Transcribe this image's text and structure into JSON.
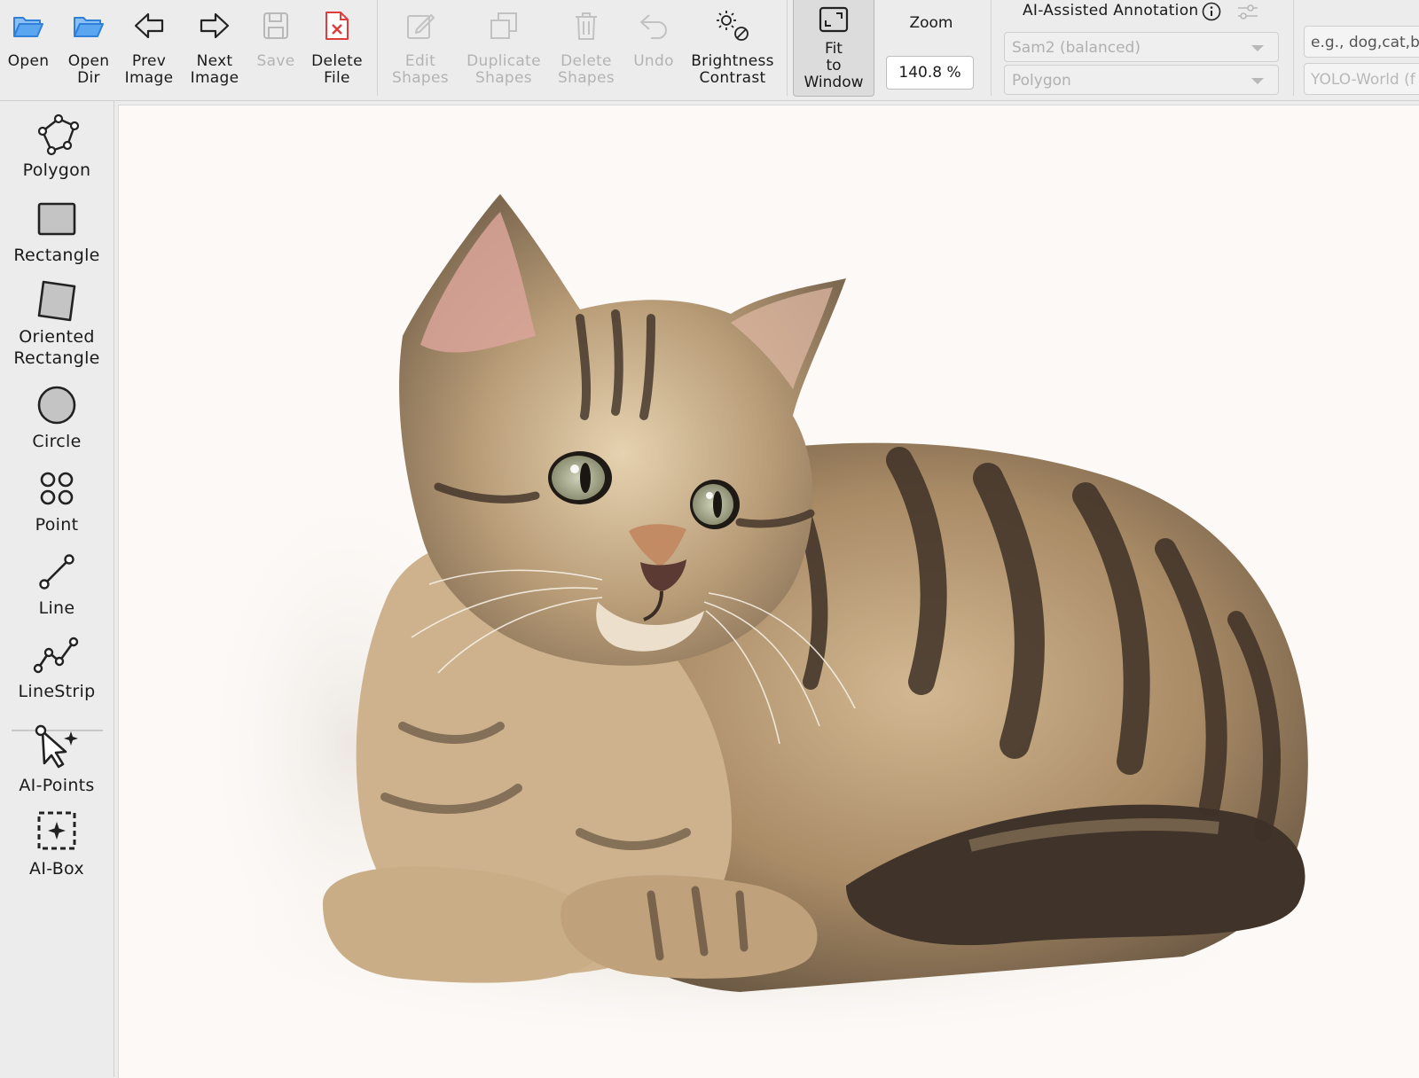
{
  "toolbar": {
    "open": "Open",
    "open_dir": "Open\nDir",
    "prev_image": "Prev\nImage",
    "next_image": "Next\nImage",
    "save": "Save",
    "delete_file": "Delete\nFile",
    "edit_shapes": "Edit\nShapes",
    "duplicate_shapes": "Duplicate\nShapes",
    "delete_shapes": "Delete\nShapes",
    "undo": "Undo",
    "brightness_contrast": "Brightness\nContrast",
    "fit_to_window": "Fit\nto\nWindow",
    "zoom_label": "Zoom",
    "zoom_value": "140.8 %"
  },
  "ai": {
    "title": "AI-Assisted Annotation",
    "model_value": "Sam2 (balanced)",
    "output_value": "Polygon",
    "prompt_placeholder": "e.g., dog,cat,bi",
    "detector_value": "YOLO-World (f"
  },
  "tools": {
    "polygon": "Polygon",
    "rectangle": "Rectangle",
    "oriented_rectangle": "Oriented\nRectangle",
    "circle": "Circle",
    "point": "Point",
    "line": "Line",
    "linestrip": "LineStrip",
    "ai_points": "AI-Points",
    "ai_box": "AI-Box"
  },
  "colors": {
    "accent_blue": "#3d8ee8",
    "delete_red": "#e03c3c",
    "disabled_text": "#b3b3b3"
  },
  "icons": {
    "open": "folder-open-icon",
    "open_dir": "folder-icon",
    "prev": "arrow-left-icon",
    "next": "arrow-right-icon",
    "save": "floppy-icon",
    "delete_file": "file-delete-icon",
    "edit": "edit-icon",
    "duplicate": "duplicate-icon",
    "trash": "trash-icon",
    "undo": "undo-icon",
    "brightness": "brightness-icon",
    "fit": "fit-window-icon"
  }
}
